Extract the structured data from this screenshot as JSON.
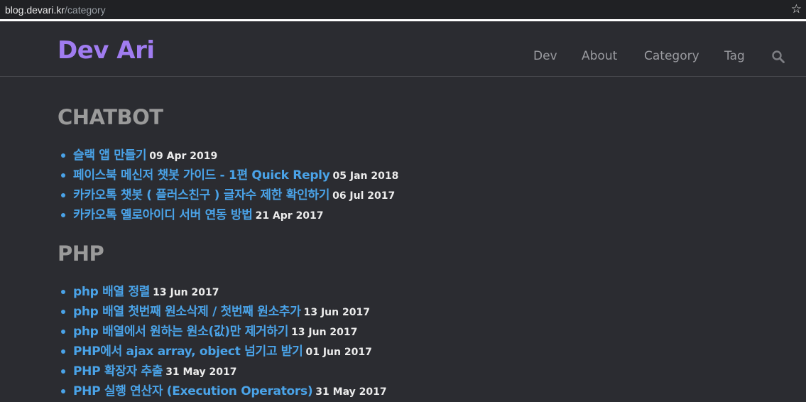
{
  "browser": {
    "url_host": "blog.devari.kr",
    "url_path": "/category"
  },
  "header": {
    "brand": "Dev Ari",
    "nav": [
      "Dev",
      "About",
      "Category",
      "Tag"
    ]
  },
  "sections": [
    {
      "title": "CHATBOT",
      "posts": [
        {
          "title": "슬랙 앱 만들기",
          "date": "09 Apr 2019"
        },
        {
          "title": "페이스북 메신저 챗봇 가이드 - 1편 Quick Reply",
          "date": "05 Jan 2018"
        },
        {
          "title": "카카오톡 챗봇 ( 플러스친구 ) 글자수 제한 확인하기",
          "date": "06 Jul 2017"
        },
        {
          "title": "카카오톡 옐로아이디 서버 연동 방법",
          "date": "21 Apr 2017"
        }
      ]
    },
    {
      "title": "PHP",
      "posts": [
        {
          "title": "php 배열 정렬",
          "date": "13 Jun 2017"
        },
        {
          "title": "php 배열 첫번째 원소삭제 / 첫번째 원소추가",
          "date": "13 Jun 2017"
        },
        {
          "title": "php 배열에서 원하는 원소(값)만 제거하기",
          "date": "13 Jun 2017"
        },
        {
          "title": "PHP에서 ajax array, object 넘기고 받기",
          "date": "01 Jun 2017"
        },
        {
          "title": "PHP 확장자 추출",
          "date": "31 May 2017"
        },
        {
          "title": "PHP 실행 연산자 (Execution Operators)",
          "date": "31 May 2017"
        }
      ]
    }
  ],
  "colors": {
    "background": "#2b2c31",
    "brand": "#a07cf0",
    "link": "#4aa3e8",
    "date": "#ececec",
    "heading": "#9a9a9a"
  }
}
